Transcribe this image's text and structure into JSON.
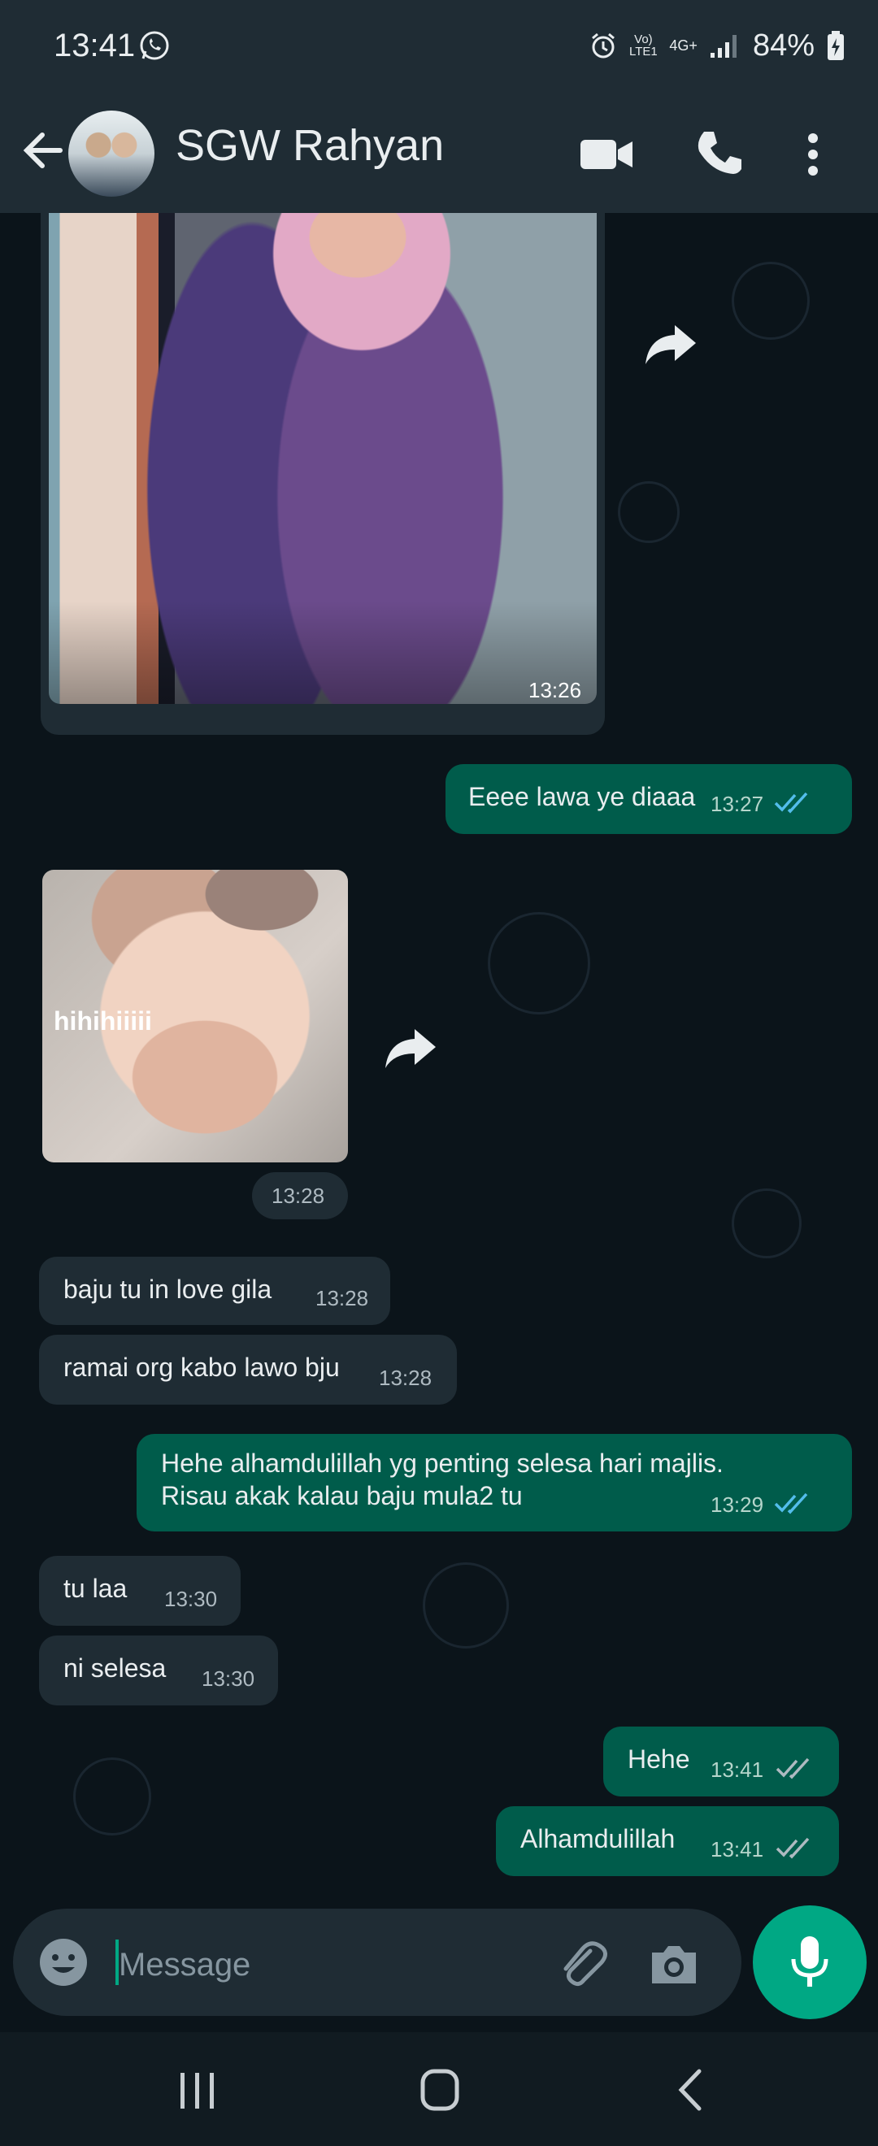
{
  "status_bar": {
    "time": "13:41",
    "battery": "84%",
    "network": "4G+",
    "volte": "Vo) LTE1"
  },
  "header": {
    "contact_name": "SGW Rahyan"
  },
  "messages": [
    {
      "type": "image",
      "direction": "in",
      "time": "13:26"
    },
    {
      "type": "text",
      "direction": "out",
      "text": "Eeee lawa ye diaaa",
      "time": "13:27",
      "status": "read"
    },
    {
      "type": "sticker",
      "direction": "in",
      "overlay_text": "hihihiiiii",
      "time": "13:28"
    },
    {
      "type": "text",
      "direction": "in",
      "text": "baju tu in love gila",
      "time": "13:28"
    },
    {
      "type": "text",
      "direction": "in",
      "text": "ramai org kabo lawo bju",
      "time": "13:28"
    },
    {
      "type": "text",
      "direction": "out",
      "text": "Hehe alhamdulillah yg penting selesa hari majlis.\nRisau akak kalau baju mula2 tu",
      "time": "13:29",
      "status": "read"
    },
    {
      "type": "text",
      "direction": "in",
      "text": "tu laa",
      "time": "13:30"
    },
    {
      "type": "text",
      "direction": "in",
      "text": "ni selesa",
      "time": "13:30"
    },
    {
      "type": "text",
      "direction": "out",
      "text": "Hehe",
      "time": "13:41",
      "status": "delivered"
    },
    {
      "type": "text",
      "direction": "out",
      "text": "Alhamdulillah",
      "time": "13:41",
      "status": "delivered"
    }
  ],
  "composer": {
    "placeholder": "Message"
  },
  "colors": {
    "header_bg": "#1f2c34",
    "chat_bg": "#0b141a",
    "bubble_in": "#1f2c34",
    "bubble_out": "#005c4b",
    "accent": "#00a884",
    "read_tick": "#53bdeb"
  }
}
